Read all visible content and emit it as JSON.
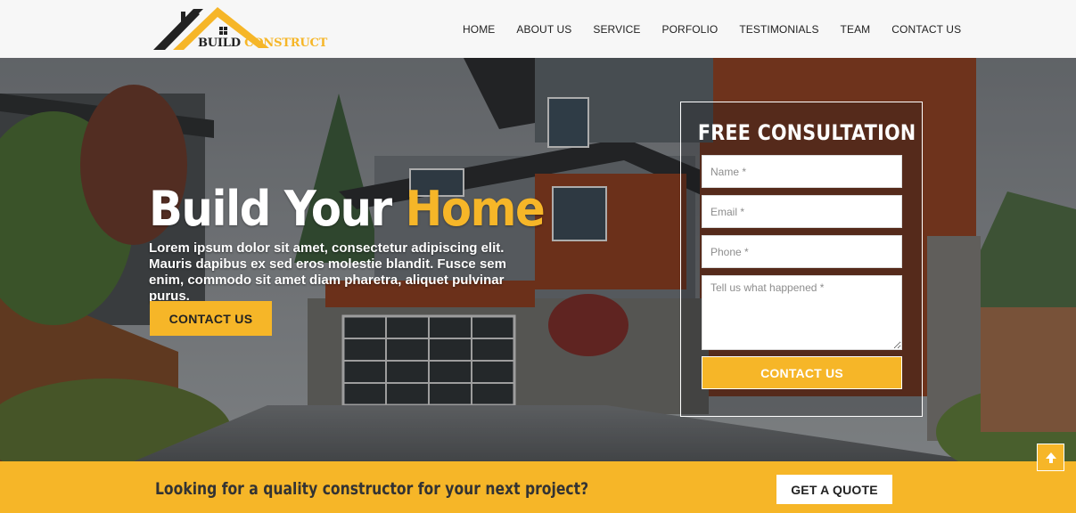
{
  "brand": {
    "logo_word1": "BUILD",
    "logo_word2": "CONSTRUCT",
    "accent_color": "#f6b628"
  },
  "nav": {
    "items": [
      "HOME",
      "ABOUT US",
      "SERVICE",
      "PORFOLIO",
      "TESTIMONIALS",
      "TEAM",
      "CONTACT US"
    ]
  },
  "hero": {
    "title_part1": "Build Your ",
    "title_accent": "Home",
    "description": "Lorem ipsum dolor sit amet, consectetur adipiscing elit. Mauris dapibus ex sed eros molestie blandit. Fusce sem enim, commodo sit amet diam pharetra, aliquet pulvinar purus.",
    "button_label": "CONTACT US"
  },
  "consultation_form": {
    "title": "FREE CONSULTATION",
    "name_placeholder": "Name *",
    "email_placeholder": "Email *",
    "phone_placeholder": "Phone *",
    "message_placeholder": "Tell us what happened *",
    "submit_label": "CONTACT US"
  },
  "cta": {
    "text": "Looking for a quality constructor for your next project?",
    "button_label": "GET A QUOTE"
  },
  "icons": {
    "scroll_top": "arrow-up-icon",
    "logo": "house-roof-icon"
  }
}
